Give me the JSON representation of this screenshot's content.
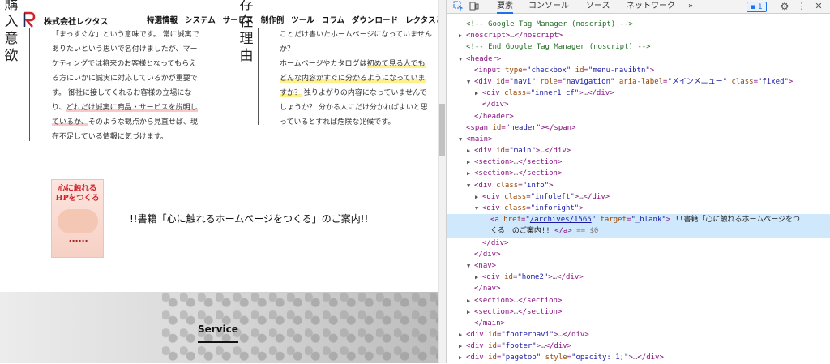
{
  "site": {
    "logo_text": "株式会社レクタス",
    "nav": [
      "特選情報",
      "システム",
      "サービス",
      "制作例",
      "ツール",
      "コラム",
      "ダウンロード",
      "レクタスとは"
    ],
    "left_title": "購入意欲",
    "right_title": "存在理由",
    "left_lines": [
      "「まっすぐな」という意味です。 常に誠実で",
      "ありたいという思いで名付けましたが、マー",
      "ケティングでは将来のお客様となってもらえ",
      "る方にいかに誠実に対応しているかが重要で",
      "す。 御社に接してくれるお客様の立場にな",
      "り、",
      "どれだけ誠実に商品・サービスを説明し",
      "ているか、",
      "そのような観点から見直せば、現",
      "在不足している情報に気づけます。"
    ],
    "right_lines": [
      "ことだけ書いたホームページになっていません",
      "か？",
      "ホームページやカタログは",
      "初めて見る人でも",
      "どんな内容かすぐに分かるようになっていま",
      "すか？",
      " 独りよがりの内容になっていませんで",
      "しょうか？ 分かる人にだけ分かればよいと思",
      "っているとすれば危険な兆候です。"
    ],
    "book_cover_title": "心に触れる HPをつくる",
    "book_link": "!!書籍「心に触れるホームページをつくる」のご案内!!",
    "service_heading": "Service"
  },
  "devtools": {
    "tabs": [
      "要素",
      "コンソール",
      "ソース",
      "ネットワーク"
    ],
    "more_label": "»",
    "issues_count": "1",
    "lines": [
      {
        "d": 0,
        "tw": "",
        "h": "<span class=\"cm\">&lt;!-- Google Tag Manager (noscript) --&gt;</span>"
      },
      {
        "d": 0,
        "tw": "▶",
        "h": "<span class=\"tag\">&lt;noscript&gt;</span><span class=\"gr\">…</span><span class=\"tag\">&lt;/noscript&gt;</span>"
      },
      {
        "d": 0,
        "tw": "",
        "h": "<span class=\"cm\">&lt;!-- End Google Tag Manager (noscript) --&gt;</span>"
      },
      {
        "d": 0,
        "tw": "▼",
        "h": "<span class=\"tag\">&lt;header&gt;</span>"
      },
      {
        "d": 1,
        "tw": "",
        "h": "<span class=\"tag\">&lt;input </span><span class=\"an\">type</span>=<span class=\"av\">\"checkbox\"</span> <span class=\"an\">id</span>=<span class=\"av\">\"menu-navibtn\"</span><span class=\"tag\">&gt;</span>"
      },
      {
        "d": 1,
        "tw": "▼",
        "h": "<span class=\"tag\">&lt;div </span><span class=\"an\">id</span>=<span class=\"av\">\"navi\"</span> <span class=\"an\">role</span>=<span class=\"av\">\"navigation\"</span> <span class=\"an\">aria-label</span>=<span class=\"av\">\"メインメニュー\"</span> <span class=\"an\">class</span>=<span class=\"av\">\"fixed\"</span><span class=\"tag\">&gt;</span>"
      },
      {
        "d": 2,
        "tw": "▶",
        "h": "<span class=\"tag\">&lt;div </span><span class=\"an\">class</span>=<span class=\"av\">\"inner1 cf\"</span><span class=\"tag\">&gt;</span><span class=\"gr\">…</span><span class=\"tag\">&lt;/div&gt;</span>"
      },
      {
        "d": 2,
        "tw": "",
        "h": "<span class=\"tag\">&lt;/div&gt;</span>"
      },
      {
        "d": 1,
        "tw": "",
        "h": "<span class=\"tag\">&lt;/header&gt;</span>"
      },
      {
        "d": 0,
        "tw": "",
        "h": "<span class=\"tag\">&lt;span </span><span class=\"an\">id</span>=<span class=\"av\">\"header\"</span><span class=\"tag\">&gt;&lt;/span&gt;</span>"
      },
      {
        "d": 0,
        "tw": "▼",
        "h": "<span class=\"tag\">&lt;main&gt;</span>"
      },
      {
        "d": 1,
        "tw": "▶",
        "h": "<span class=\"tag\">&lt;div </span><span class=\"an\">id</span>=<span class=\"av\">\"main\"</span><span class=\"tag\">&gt;</span><span class=\"gr\">…</span><span class=\"tag\">&lt;/div&gt;</span>"
      },
      {
        "d": 1,
        "tw": "▶",
        "h": "<span class=\"tag\">&lt;section&gt;</span><span class=\"gr\">…</span><span class=\"tag\">&lt;/section&gt;</span>"
      },
      {
        "d": 1,
        "tw": "▶",
        "h": "<span class=\"tag\">&lt;section&gt;</span><span class=\"gr\">…</span><span class=\"tag\">&lt;/section&gt;</span>"
      },
      {
        "d": 1,
        "tw": "▼",
        "h": "<span class=\"tag\">&lt;div </span><span class=\"an\">class</span>=<span class=\"av\">\"info\"</span><span class=\"tag\">&gt;</span>"
      },
      {
        "d": 2,
        "tw": "▶",
        "h": "<span class=\"tag\">&lt;div </span><span class=\"an\">class</span>=<span class=\"av\">\"infoleft\"</span><span class=\"tag\">&gt;</span><span class=\"gr\">…</span><span class=\"tag\">&lt;/div&gt;</span>"
      },
      {
        "d": 2,
        "tw": "▼",
        "h": "<span class=\"tag\">&lt;div </span><span class=\"an\">class</span>=<span class=\"av\">\"inforight\"</span><span class=\"tag\">&gt;</span>"
      },
      {
        "d": 3,
        "tw": "",
        "sel": true,
        "h": "<span class=\"tag\">&lt;a </span><span class=\"an\">href</span>=<span class=\"av\">\"<span class=\"lk\">/archives/1565</span>\"</span> <span class=\"an\">target</span>=<span class=\"av\">\"_blank\"</span><span class=\"tag\">&gt;</span><span class=\"tx\"> !!書籍「心に触れるホームページをつ</span>"
      },
      {
        "d": 3,
        "tw": "",
        "sel": true,
        "h": "<span class=\"tx\">くる」のご案内!! </span><span class=\"tag\">&lt;/a&gt;</span> <span class=\"gr\">== $0</span>"
      },
      {
        "d": 2,
        "tw": "",
        "h": "<span class=\"tag\">&lt;/div&gt;</span>"
      },
      {
        "d": 1,
        "tw": "",
        "h": "<span class=\"tag\">&lt;/div&gt;</span>"
      },
      {
        "d": 1,
        "tw": "▼",
        "h": "<span class=\"tag\">&lt;nav&gt;</span>"
      },
      {
        "d": 2,
        "tw": "▶",
        "h": "<span class=\"tag\">&lt;div </span><span class=\"an\">id</span>=<span class=\"av\">\"home2\"</span><span class=\"tag\">&gt;</span><span class=\"gr\">…</span><span class=\"tag\">&lt;/div&gt;</span>"
      },
      {
        "d": 1,
        "tw": "",
        "h": "<span class=\"tag\">&lt;/nav&gt;</span>"
      },
      {
        "d": 1,
        "tw": "▶",
        "h": "<span class=\"tag\">&lt;section&gt;</span><span class=\"gr\">…</span><span class=\"tag\">&lt;/section&gt;</span>"
      },
      {
        "d": 1,
        "tw": "▶",
        "h": "<span class=\"tag\">&lt;section&gt;</span><span class=\"gr\">…</span><span class=\"tag\">&lt;/section&gt;</span>"
      },
      {
        "d": 1,
        "tw": "",
        "h": "<span class=\"tag\">&lt;/main&gt;</span>"
      },
      {
        "d": 0,
        "tw": "▶",
        "h": "<span class=\"tag\">&lt;div </span><span class=\"an\">id</span>=<span class=\"av\">\"footernavi\"</span><span class=\"tag\">&gt;</span><span class=\"gr\">…</span><span class=\"tag\">&lt;/div&gt;</span>"
      },
      {
        "d": 0,
        "tw": "▶",
        "h": "<span class=\"tag\">&lt;div </span><span class=\"an\">id</span>=<span class=\"av\">\"footer\"</span><span class=\"tag\">&gt;</span><span class=\"gr\">…</span><span class=\"tag\">&lt;/div&gt;</span>"
      },
      {
        "d": 0,
        "tw": "▶",
        "h": "<span class=\"tag\">&lt;div </span><span class=\"an\">id</span>=<span class=\"av\">\"pagetop\"</span> <span class=\"an\">style</span>=<span class=\"av\">\"opacity: 1;\"</span><span class=\"tag\">&gt;</span><span class=\"gr\">…</span><span class=\"tag\">&lt;/div&gt;</span>"
      }
    ]
  },
  "colors": {
    "accent": "#1a73e8",
    "logo_red": "#d0232c",
    "selected_row": "#cfe8fc"
  }
}
